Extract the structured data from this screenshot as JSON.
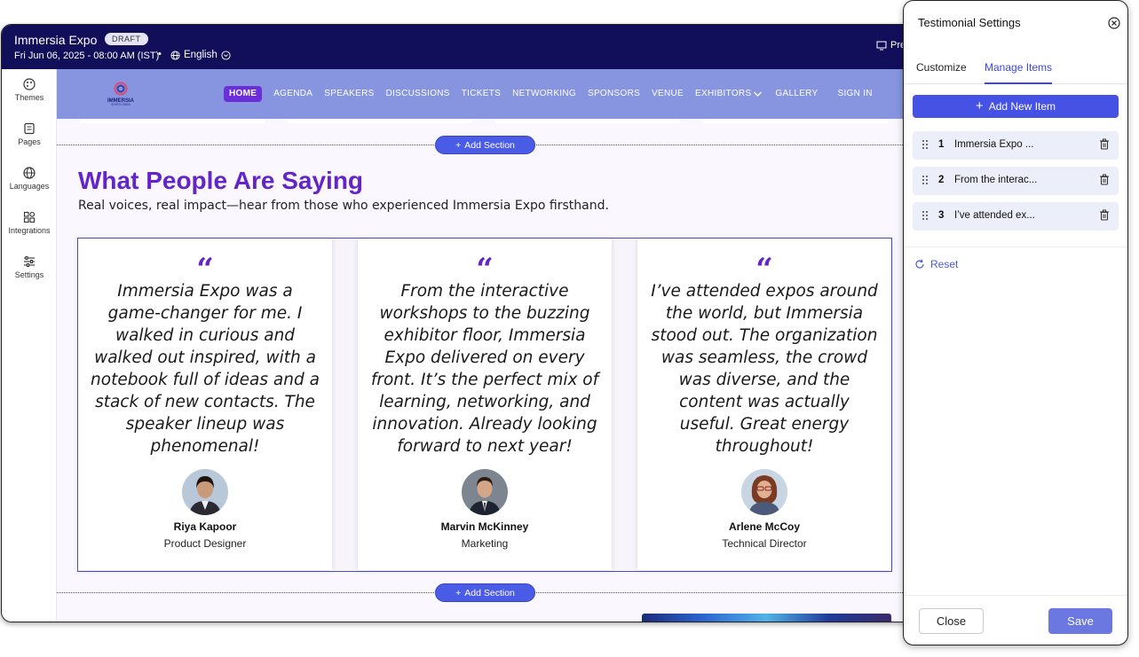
{
  "topbar": {
    "event_title": "Immersia Expo",
    "status_badge": "DRAFT",
    "event_date": "Fri Jun 06, 2025 - 08:00 AM (IST)",
    "separator": "•",
    "language": "English",
    "preview_label": "Pre"
  },
  "sidebar": {
    "items": [
      {
        "label": "Themes",
        "icon": "palette-icon"
      },
      {
        "label": "Pages",
        "icon": "pages-icon"
      },
      {
        "label": "Languages",
        "icon": "globe-icon"
      },
      {
        "label": "Integrations",
        "icon": "integrations-icon"
      },
      {
        "label": "Settings",
        "icon": "sliders-icon"
      }
    ]
  },
  "site_nav": {
    "logo_text": "IMMERSIA",
    "logo_subtext": "EXPO 2025",
    "links": [
      "HOME",
      "AGENDA",
      "SPEAKERS",
      "DISCUSSIONS",
      "TICKETS",
      "NETWORKING",
      "SPONSORS",
      "VENUE",
      "EXHIBITORS",
      "GALLERY",
      "SIGN IN"
    ]
  },
  "add_section_label": "Add Section",
  "testimonials": {
    "title": "What People Are Saying",
    "subtitle": "Real voices, real impact—hear from those who experienced Immersia Expo firsthand.",
    "quote_mark": "“",
    "items": [
      {
        "quote": "Immersia Expo was a game-changer for me. I walked in curious and walked out inspired, with a notebook full of ideas and a stack of new contacts. The speaker lineup was phenomenal!",
        "name": "Riya Kapoor",
        "role": "Product Designer"
      },
      {
        "quote": "From the interactive workshops to the buzzing exhibitor floor, Immersia Expo delivered on every front. It’s the perfect mix of learning, networking, and innovation. Already looking forward to next year!",
        "name": "Marvin McKinney",
        "role": "Marketing"
      },
      {
        "quote": "I’ve attended expos around the world, but Immersia stood out. The organization was seamless, the crowd was diverse, and the content was actually useful. Great energy throughout!",
        "name": "Arlene McCoy",
        "role": "Technical Director"
      }
    ]
  },
  "panel": {
    "title": "Testimonial Settings",
    "tabs": [
      "Customize",
      "Manage Items"
    ],
    "active_tab": "Manage Items",
    "add_item_label": "Add New Item",
    "items": [
      {
        "num": "1",
        "label": "Immersia Expo ..."
      },
      {
        "num": "2",
        "label": "From the interac..."
      },
      {
        "num": "3",
        "label": "I’ve attended ex..."
      }
    ],
    "reset_label": "Reset",
    "close_label": "Close",
    "save_label": "Save"
  },
  "colors": {
    "topbar": "#120f5a",
    "accent_purple": "#6325c8",
    "primary_blue": "#4552e4",
    "nav_bg": "#8795e0"
  }
}
